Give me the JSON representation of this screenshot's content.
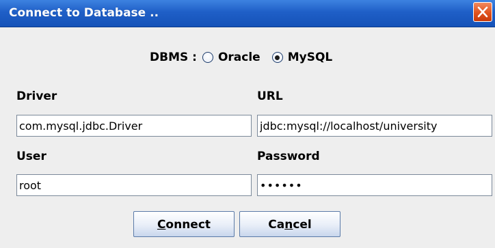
{
  "window": {
    "title": "Connect to Database .."
  },
  "dbms": {
    "label": "DBMS :",
    "options": [
      {
        "label": "Oracle",
        "checked": false
      },
      {
        "label": "MySQL",
        "checked": true
      }
    ]
  },
  "form": {
    "driver_label": "Driver",
    "driver_value": "com.mysql.jdbc.Driver",
    "url_label": "URL",
    "url_value": "jdbc:mysql://localhost/university",
    "user_label": "User",
    "user_value": "root",
    "password_label": "Password",
    "password_value": "secret"
  },
  "buttons": {
    "connect_mnemonic": "C",
    "connect_rest": "onnect",
    "cancel_prefix": "Ca",
    "cancel_mnemonic": "n",
    "cancel_rest": "cel"
  },
  "colors": {
    "titlebar": "#1f5fc7",
    "close": "#e0521d",
    "background": "#eeeeee"
  }
}
